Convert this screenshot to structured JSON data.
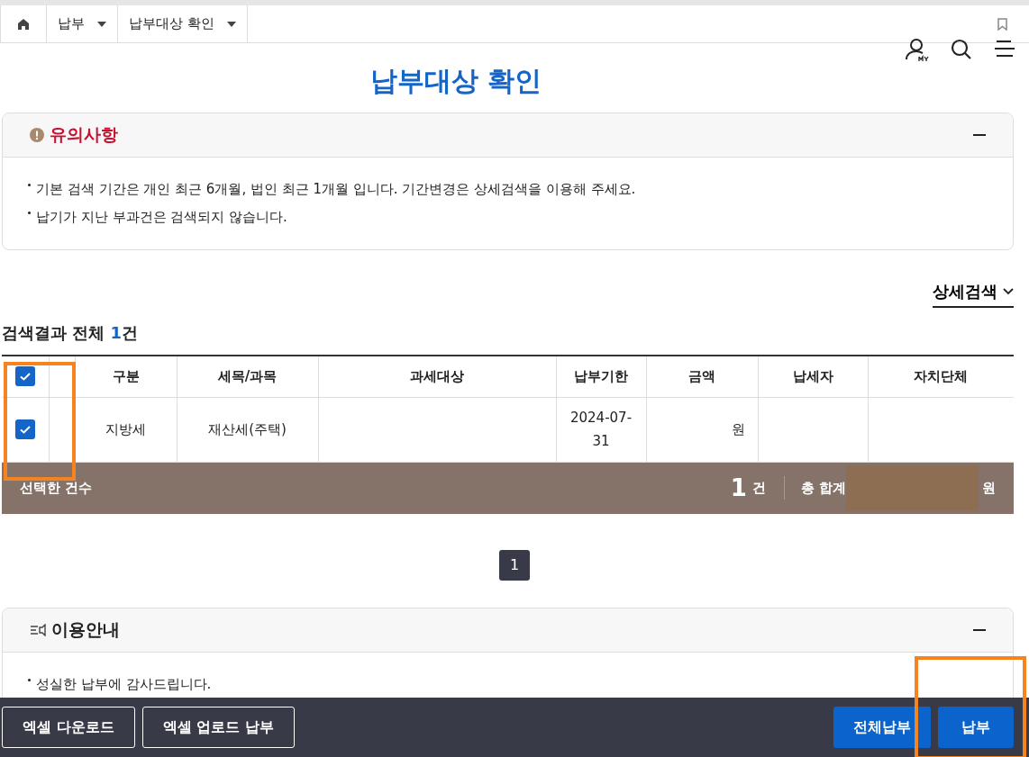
{
  "breadcrumbs": [
    {
      "label": "납부"
    },
    {
      "label": "납부대상 확인"
    }
  ],
  "title": "납부대상 확인",
  "notice": {
    "title": "유의사항",
    "expanded": true,
    "items": [
      "기본 검색 기간은 개인 최근 6개월, 법인 최근 1개월 입니다. 기간변경은 상세검색을 이용해 주세요.",
      "납기가 지난 부과건은 검색되지 않습니다."
    ]
  },
  "detail_search": "상세검색",
  "result": {
    "label": "검색결과 전체",
    "count": "1",
    "suffix": "건"
  },
  "table": {
    "all_checked": true,
    "columns": [
      "구분",
      "세목/과목",
      "과세대상",
      "납부기한",
      "금액",
      "납세자",
      "자치단체"
    ],
    "rows": [
      {
        "checked": true,
        "cells": [
          "지방세",
          "재산세(주택)",
          "",
          "2024-07-31",
          "원",
          "",
          ""
        ]
      }
    ]
  },
  "summary": {
    "label": "선택한 건수",
    "count": "1",
    "count_unit": "건",
    "total_label": "총 합계",
    "total_unit": "원"
  },
  "pagination": [
    {
      "label": "1",
      "selected": true
    }
  ],
  "guide": {
    "title": "이용안내",
    "expanded": true,
    "items": [
      "성실한 납부에 감사드립니다."
    ]
  },
  "footer": [
    {
      "label": "엑셀 다운로드",
      "kind": "outline"
    },
    {
      "label": "엑셀 업로드 납부",
      "kind": "outline"
    },
    {
      "label": "전체납부",
      "kind": "primary"
    },
    {
      "label": "납부",
      "kind": "primary"
    }
  ]
}
